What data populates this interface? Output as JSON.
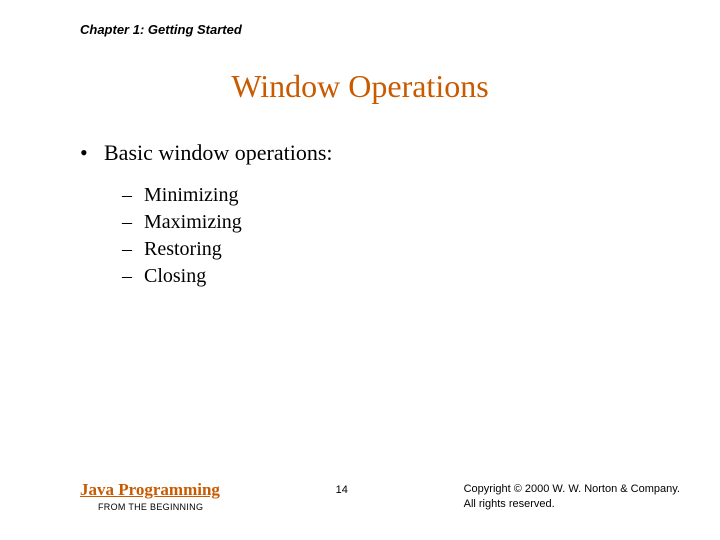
{
  "header": {
    "chapter": "Chapter 1: Getting Started"
  },
  "title": "Window Operations",
  "bullets": {
    "primary": "Basic window operations:",
    "secondary": [
      "Minimizing",
      "Maximizing",
      "Restoring",
      "Closing"
    ]
  },
  "footer": {
    "book_title": "Java Programming",
    "book_subtitle": "FROM THE BEGINNING",
    "page_number": "14",
    "copyright_line1": "Copyright © 2000 W. W. Norton & Company.",
    "copyright_line2": "All rights reserved."
  }
}
